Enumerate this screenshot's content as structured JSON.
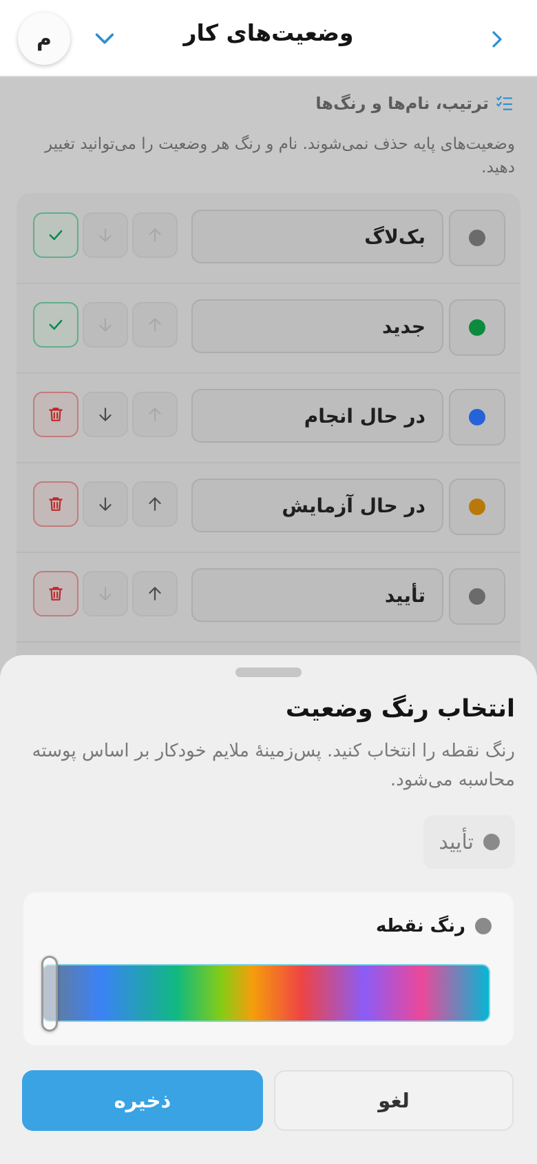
{
  "header": {
    "title": "وضعیت‌های کار",
    "avatar_letter": "م"
  },
  "section": {
    "title": "ترتیب، نام‌ها و رنگ‌ها",
    "description": "وضعیت‌های پایه حذف نمی‌شوند. نام و رنگ هر وضعیت را می‌توانید تغییر دهید."
  },
  "statuses": [
    {
      "name": "بک‌لاگ",
      "dot_color": "#6b6b6b",
      "action": "base",
      "up_enabled": false,
      "down_enabled": false
    },
    {
      "name": "جدید",
      "dot_color": "#0c8b3e",
      "action": "base",
      "up_enabled": false,
      "down_enabled": false
    },
    {
      "name": "در حال انجام",
      "dot_color": "#2563d9",
      "action": "delete",
      "up_enabled": false,
      "down_enabled": true
    },
    {
      "name": "در حال آزمایش",
      "dot_color": "#b9780a",
      "action": "delete",
      "up_enabled": true,
      "down_enabled": true
    },
    {
      "name": "تأیید",
      "dot_color": "#6b6b6b",
      "action": "delete",
      "up_enabled": true,
      "down_enabled": false
    }
  ],
  "sheet": {
    "title": "انتخاب رنگ وضعیت",
    "description": "رنگ نقطه را انتخاب کنید. پس‌زمینهٔ ملایم خودکار بر اساس پوسته محاسبه می‌شود.",
    "preview_label": "تأیید",
    "color_label": "رنگ نقطه",
    "hue_value": 0,
    "cancel_label": "لغو",
    "save_label": "ذخیره"
  },
  "colors": {
    "accent": "#3aa3e3",
    "check": "#0a8a4f",
    "delete": "#c02626",
    "selected_dot": "#8a8a8a"
  }
}
